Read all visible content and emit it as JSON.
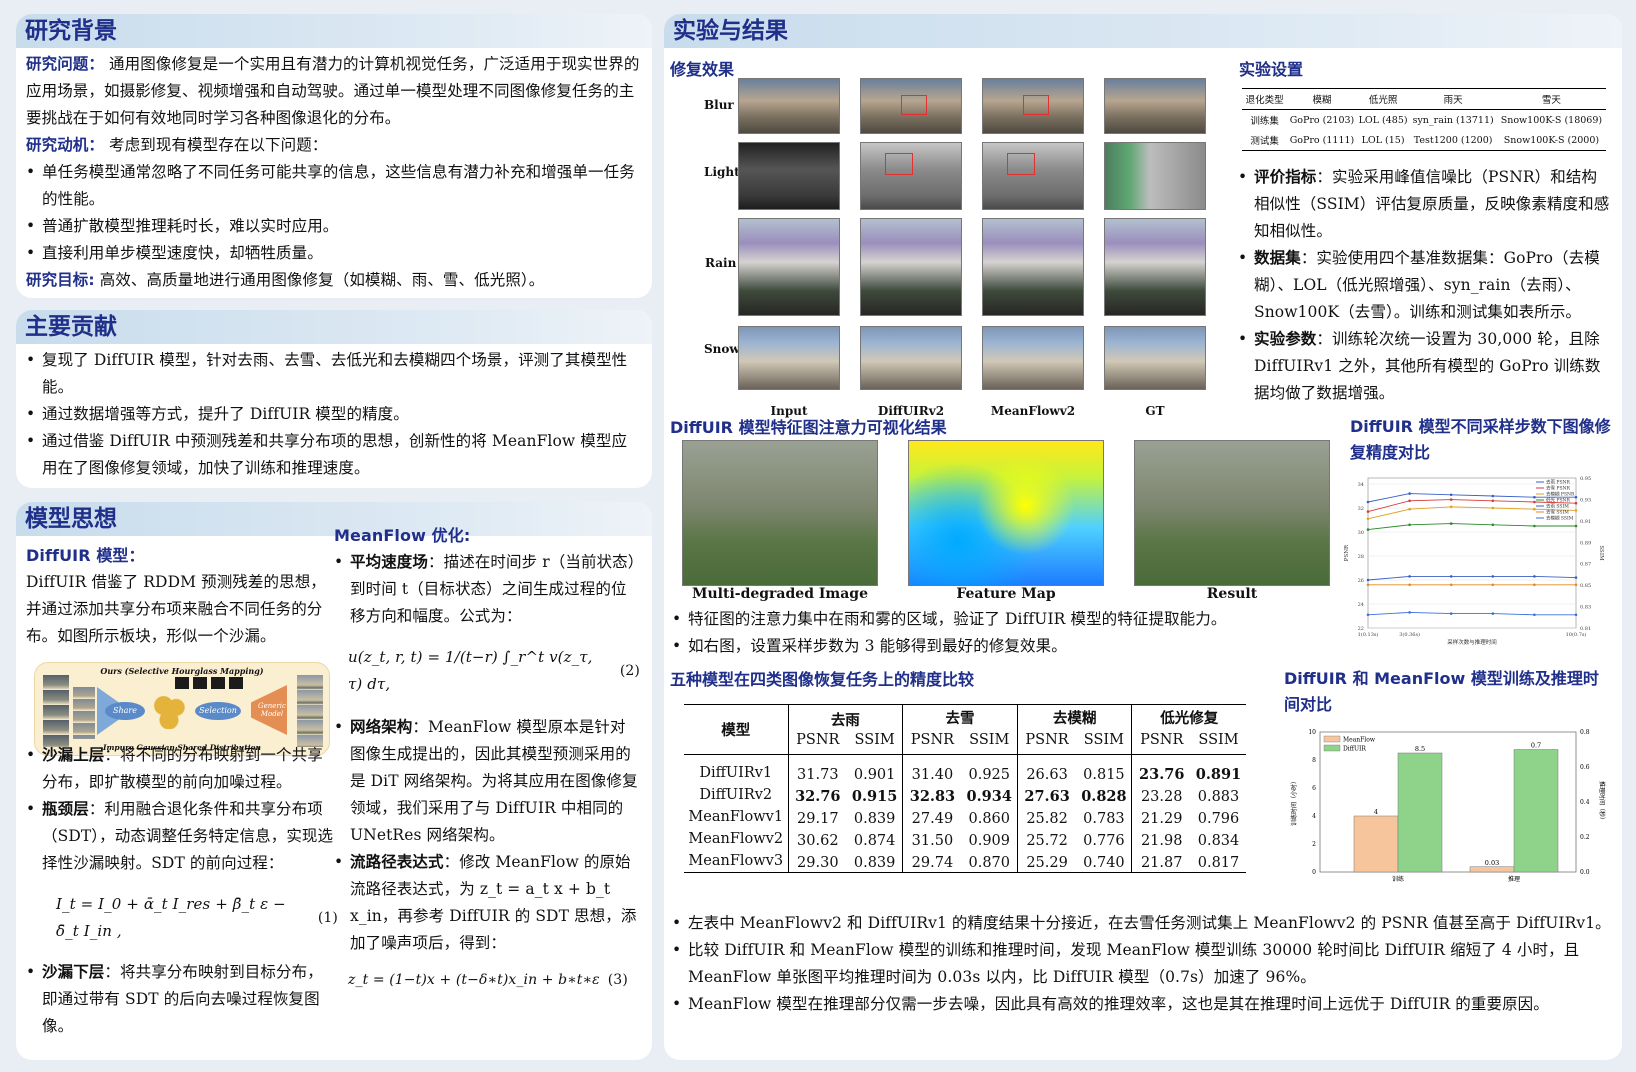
{
  "bg": {
    "title": "研究背景",
    "q_head": "研究问题：",
    "q_text": " 通用图像修复是一个实用且有潜力的计算机视觉任务，广泛适用于现实世界的应用场景，如摄影修复、视频增强和自动驾驶。通过单一模型处理不同图像修复任务的主要挑战在于如何有效地同时学习各种图像退化的分布。",
    "m_head": "研究动机：",
    "m_text": " 考虑到现有模型存在以下问题：",
    "bullets": [
      "单任务模型通常忽略了不同任务可能共享的信息，这些信息有潜力补充和增强单一任务的性能。",
      "普通扩散模型推理耗时长，难以实时应用。",
      "直接利用单步模型速度快，却牺牲质量。"
    ],
    "g_head": "研究目标:",
    "g_text": " 高效、高质量地进行通用图像修复（如模糊、雨、雪、低光照）。"
  },
  "contrib": {
    "title": "主要贡献",
    "bullets": [
      "复现了 DiffUIR 模型，针对去雨、去雪、去低光和去模糊四个场景，评测了其模型性能。",
      "通过数据增强等方式，提升了 DiffUIR 模型的精度。",
      "通过借鉴 DiffUIR 中预测残差和共享分布项的思想，创新性的将 MeanFlow 模型应用在了图像修复领域，加快了训练和推理速度。"
    ]
  },
  "model": {
    "title": "模型思想",
    "left_head": "DiffUIR 模型：",
    "left_text": "DiffUIR 借鉴了 RDDM 预测残差的思想，并通过添加共享分布项来融合不同任务的分布。如图所示板块，形似一个沙漏。",
    "diagram_title": "Ours (Selective Hourglass Mapping)",
    "diagram_share": "Share",
    "diagram_selection": "Selection",
    "diagram_generic": "Generic Model",
    "diagram_caption": "Impure Gaussian Shared Distribution",
    "upper_head": "沙漏上层",
    "upper_text": "：将不同的分布映射到一个共享分布，即扩散模型的前向加噪过程。",
    "neck_head": "瓶颈层",
    "neck_text": "：利用融合退化条件和共享分布项（SDT），动态调整任务特定信息，实现选择性沙漏映射。SDT 的前向过程：",
    "eq1": "I_t = I_0 + ᾱ_t I_res + β̄_t ε − δ̄_t I_in ,",
    "eq1_num": "(1)",
    "lower_head": "沙漏下层",
    "lower_text": "：将共享分布映射到目标分布，即通过带有 SDT 的后向去噪过程恢复图像。",
    "right_head": "MeanFlow 优化:",
    "mv_head": "平均速度场",
    "mv_text": "：描述在时间步 r（当前状态）到时间 t（目标状态）之间生成过程的位移方向和幅度。公式为：",
    "eq2": "u(z_t, r, t) = 1/(t−r) ∫_r^t v(z_τ, τ) dτ,",
    "eq2_num": "(2)",
    "arch_head": "网络架构",
    "arch_text": "：MeanFlow 模型原本是针对图像生成提出的，因此其模型预测采用的是 DiT 网络架构。为将其应用在图像修复领域，我们采用了与 DiffUIR 中相同的 UNetRes 网络架构。",
    "flow_head": "流路径表达式",
    "flow_text": "：修改 MeanFlow 的原始流路径表达式，为 z_t = a_t x + b_t x_in，再参考 DiffUIR 的 SDT 思想，添加了噪声项后，得到：",
    "eq3": "z_t = (1−t)x + (t−δ∗t)x_in + b∗t∗ε",
    "eq3_num": "(3)"
  },
  "results": {
    "title": "实验与结果",
    "restore_head": "修复效果",
    "rows": [
      "Blur",
      "Light",
      "Rain",
      "Snow"
    ],
    "cols": [
      "Input",
      "DiffUIRv2",
      "MeanFlowv2",
      "GT"
    ],
    "setup_head": "实验设置",
    "setup_table": {
      "header": [
        "退化类型",
        "模糊",
        "低光照",
        "雨天",
        "雪天"
      ],
      "rows": [
        [
          "训练集",
          "GoPro (2103)",
          "LOL (485)",
          "syn_rain (13711)",
          "Snow100K-S (18069)"
        ],
        [
          "测试集",
          "GoPro (1111)",
          "LOL (15)",
          "Test1200 (1200)",
          "Snow100K-S (2000)"
        ]
      ]
    },
    "setup_bullets": [
      {
        "head": "评价指标",
        "text": "：实验采用峰值信噪比（PSNR）和结构相似性（SSIM）评估复原质量，反映像素精度和感知相似性。"
      },
      {
        "head": "数据集",
        "text": "：实验使用四个基准数据集：GoPro（去模糊）、LOL（低光照增强）、syn_rain（去雨）、Snow100K（去雪）。训练和测试集如表所示。"
      },
      {
        "head": "实验参数",
        "text": "：训练轮次统一设置为 30,000 轮，且除 DiffUIRv1 之外，其他所有模型的 GoPro 训练数据均做了数据增强。"
      }
    ],
    "feat_head": "DiffUIR 模型特征图注意力可视化结果",
    "feat_captions": [
      "Multi-degraded Image",
      "Feature Map",
      "Result"
    ],
    "feat_bullets": [
      "特征图的注意力集中在雨和雾的区域，验证了 DiffUIR 模型的特征提取能力。",
      "如右图，设置采样步数为 3 能够得到最好的修复效果。"
    ],
    "steps_head": "DiffUIR 模型不同采样步数下图像修复精度对比",
    "acc_head": "五种模型在四类图像恢复任务上的精度比较",
    "acc_table": {
      "model_col": "模型",
      "groups": [
        "去雨",
        "去雪",
        "去模糊",
        "低光修复"
      ],
      "metrics": [
        "PSNR",
        "SSIM"
      ],
      "rows": [
        {
          "name": "DiffUIRv1",
          "vals": [
            "31.73",
            "0.901",
            "31.40",
            "0.925",
            "26.63",
            "0.815",
            "23.76",
            "0.891"
          ]
        },
        {
          "name": "DiffUIRv2",
          "vals": [
            "32.76",
            "0.915",
            "32.83",
            "0.934",
            "27.63",
            "0.828",
            "23.28",
            "0.883"
          ]
        },
        {
          "name": "MeanFlowv1",
          "vals": [
            "29.17",
            "0.839",
            "27.49",
            "0.860",
            "25.82",
            "0.783",
            "21.29",
            "0.796"
          ]
        },
        {
          "name": "MeanFlowv2",
          "vals": [
            "30.62",
            "0.874",
            "31.50",
            "0.909",
            "25.72",
            "0.776",
            "21.98",
            "0.834"
          ]
        },
        {
          "name": "MeanFlowv3",
          "vals": [
            "29.30",
            "0.839",
            "29.74",
            "0.870",
            "25.29",
            "0.740",
            "21.87",
            "0.817"
          ]
        }
      ]
    },
    "time_head": "DiffUIR 和 MeanFlow 模型训练及推理时间对比",
    "bottom_bullets": [
      "左表中 MeanFlowv2 和 DiffUIRv1 的精度结果十分接近，在去雪任务测试集上 MeanFlowv2 的 PSNR 值甚至高于 DiffUIRv1。",
      "比较 DiffUIR 和 MeanFlow 模型的训练和推理时间，发现 MeanFlow 模型训练 30000 轮时间比 DiffUIR 缩短了 4 小时，且 MeanFlow 单张图平均推理时间为 0.03s 以内，比 DiffUIR 模型（0.7s）加速了 96%。",
      "MeanFlow 模型在推理部分仅需一步去噪，因此具有高效的推理效率，这也是其在推理时间上远优于 DiffUIR 的重要原因。"
    ]
  },
  "chart_data": [
    {
      "type": "line",
      "x": [
        1,
        2,
        3,
        4,
        5,
        6
      ],
      "x_tick_labels": [
        "1(0.13s)",
        "3(0.36s)",
        "",
        "",
        "",
        "10(0.7s)"
      ],
      "xlabel": "采样次数与推理时间",
      "ylabel": "PSNR",
      "y2label": "SSIM",
      "ylim": [
        22,
        34.5
      ],
      "y2lim": [
        0.81,
        0.95
      ],
      "series": [
        {
          "name": "去雨 PSNR",
          "color": "#3a5fc8",
          "values": [
            32.5,
            33.2,
            33.1,
            33.0,
            32.9,
            32.9
          ]
        },
        {
          "name": "去雪 PSNR",
          "color": "#d63a3a",
          "values": [
            31.7,
            32.6,
            32.7,
            32.6,
            32.5,
            32.4
          ]
        },
        {
          "name": "去模糊 PSNR",
          "color": "#e0a020",
          "values": [
            31.1,
            31.9,
            32.1,
            32.0,
            31.9,
            31.8
          ]
        },
        {
          "name": "低光 PSNR",
          "color": "#2a8a2a",
          "values": [
            30.2,
            30.6,
            30.7,
            30.6,
            30.5,
            30.5
          ]
        },
        {
          "name": "去雨 SSIM",
          "color": "#3a5fc8",
          "values": [
            26.0,
            26.3,
            26.3,
            26.3,
            26.3,
            26.2
          ]
        },
        {
          "name": "去雪 SSIM",
          "color": "#e08a20",
          "values": [
            25.6,
            25.6,
            25.6,
            25.6,
            25.6,
            25.6
          ]
        },
        {
          "name": "去模糊 SSIM",
          "color": "#3a6fe0",
          "values": [
            23.1,
            23.3,
            23.2,
            23.2,
            23.1,
            23.1
          ]
        }
      ]
    },
    {
      "type": "bar",
      "categories": [
        "训练",
        "推理"
      ],
      "series": [
        {
          "name": "MeanFlow",
          "color": "#f6c59b",
          "values": [
            4,
            0.03
          ],
          "value_labels": [
            "4",
            "0.03"
          ]
        },
        {
          "name": "DiffUIR",
          "color": "#8fd38a",
          "values": [
            8.5,
            0.7
          ],
          "value_labels": [
            "8.5",
            "0.7"
          ]
        }
      ],
      "ylabel": "训练时间（小时）",
      "y2label": "推理时间（秒）",
      "ylim": [
        0,
        10
      ],
      "y2lim": [
        0,
        0.8
      ]
    }
  ]
}
